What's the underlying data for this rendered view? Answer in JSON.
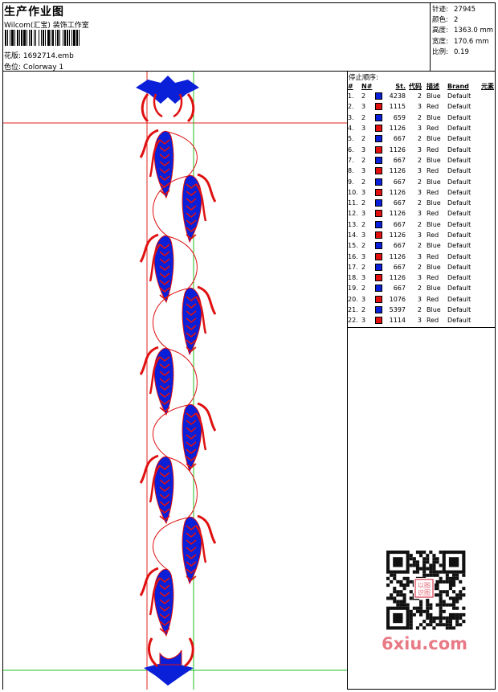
{
  "header": {
    "title": "生产作业图",
    "company": "Wilcom(汇宝) 装饰工作室",
    "design_label": "花版:",
    "design_file": "1692714.emb",
    "colorway_label": "色位:",
    "colorway": "Colorway 1"
  },
  "stats": [
    {
      "label": "针迹:",
      "value": "27945"
    },
    {
      "label": "颜色:",
      "value": "2"
    },
    {
      "label": "高度:",
      "value": "1363.0 mm"
    },
    {
      "label": "宽度:",
      "value": "170.6 mm"
    },
    {
      "label": "比例:",
      "value": "0.19"
    }
  ],
  "sequence": {
    "title": "停止顺序:",
    "headers": {
      "num": "#",
      "needle": "N#",
      "stitches": "St.",
      "code": "代码",
      "desc": "描述",
      "brand": "Brand",
      "element": "元素"
    },
    "colors": {
      "Blue": "#0a1fd8",
      "Red": "#e01010"
    },
    "rows": [
      {
        "n": "1.",
        "needle": "2",
        "color": "Blue",
        "st": "4238",
        "code": "2",
        "desc": "Blue",
        "brand": "Default"
      },
      {
        "n": "2.",
        "needle": "3",
        "color": "Red",
        "st": "1115",
        "code": "3",
        "desc": "Red",
        "brand": "Default"
      },
      {
        "n": "3.",
        "needle": "2",
        "color": "Blue",
        "st": "659",
        "code": "2",
        "desc": "Blue",
        "brand": "Default"
      },
      {
        "n": "4.",
        "needle": "3",
        "color": "Red",
        "st": "1126",
        "code": "3",
        "desc": "Red",
        "brand": "Default"
      },
      {
        "n": "5.",
        "needle": "2",
        "color": "Blue",
        "st": "667",
        "code": "2",
        "desc": "Blue",
        "brand": "Default"
      },
      {
        "n": "6.",
        "needle": "3",
        "color": "Red",
        "st": "1126",
        "code": "3",
        "desc": "Red",
        "brand": "Default"
      },
      {
        "n": "7.",
        "needle": "2",
        "color": "Blue",
        "st": "667",
        "code": "2",
        "desc": "Blue",
        "brand": "Default"
      },
      {
        "n": "8.",
        "needle": "3",
        "color": "Red",
        "st": "1126",
        "code": "3",
        "desc": "Red",
        "brand": "Default"
      },
      {
        "n": "9.",
        "needle": "2",
        "color": "Blue",
        "st": "667",
        "code": "2",
        "desc": "Blue",
        "brand": "Default"
      },
      {
        "n": "10.",
        "needle": "3",
        "color": "Red",
        "st": "1126",
        "code": "3",
        "desc": "Red",
        "brand": "Default"
      },
      {
        "n": "11.",
        "needle": "2",
        "color": "Blue",
        "st": "667",
        "code": "2",
        "desc": "Blue",
        "brand": "Default"
      },
      {
        "n": "12.",
        "needle": "3",
        "color": "Red",
        "st": "1126",
        "code": "3",
        "desc": "Red",
        "brand": "Default"
      },
      {
        "n": "13.",
        "needle": "2",
        "color": "Blue",
        "st": "667",
        "code": "2",
        "desc": "Blue",
        "brand": "Default"
      },
      {
        "n": "14.",
        "needle": "3",
        "color": "Red",
        "st": "1126",
        "code": "3",
        "desc": "Red",
        "brand": "Default"
      },
      {
        "n": "15.",
        "needle": "2",
        "color": "Blue",
        "st": "667",
        "code": "2",
        "desc": "Blue",
        "brand": "Default"
      },
      {
        "n": "16.",
        "needle": "3",
        "color": "Red",
        "st": "1126",
        "code": "3",
        "desc": "Red",
        "brand": "Default"
      },
      {
        "n": "17.",
        "needle": "2",
        "color": "Blue",
        "st": "667",
        "code": "2",
        "desc": "Blue",
        "brand": "Default"
      },
      {
        "n": "18.",
        "needle": "3",
        "color": "Red",
        "st": "1126",
        "code": "3",
        "desc": "Red",
        "brand": "Default"
      },
      {
        "n": "19.",
        "needle": "2",
        "color": "Blue",
        "st": "667",
        "code": "2",
        "desc": "Blue",
        "brand": "Default"
      },
      {
        "n": "20.",
        "needle": "3",
        "color": "Red",
        "st": "1076",
        "code": "3",
        "desc": "Red",
        "brand": "Default"
      },
      {
        "n": "21.",
        "needle": "2",
        "color": "Blue",
        "st": "5397",
        "code": "2",
        "desc": "Blue",
        "brand": "Default"
      },
      {
        "n": "22.",
        "needle": "3",
        "color": "Red",
        "st": "1114",
        "code": "3",
        "desc": "Red",
        "brand": "Default"
      }
    ]
  },
  "watermark": "6xiu.com",
  "qr_stamp": "以图识图"
}
